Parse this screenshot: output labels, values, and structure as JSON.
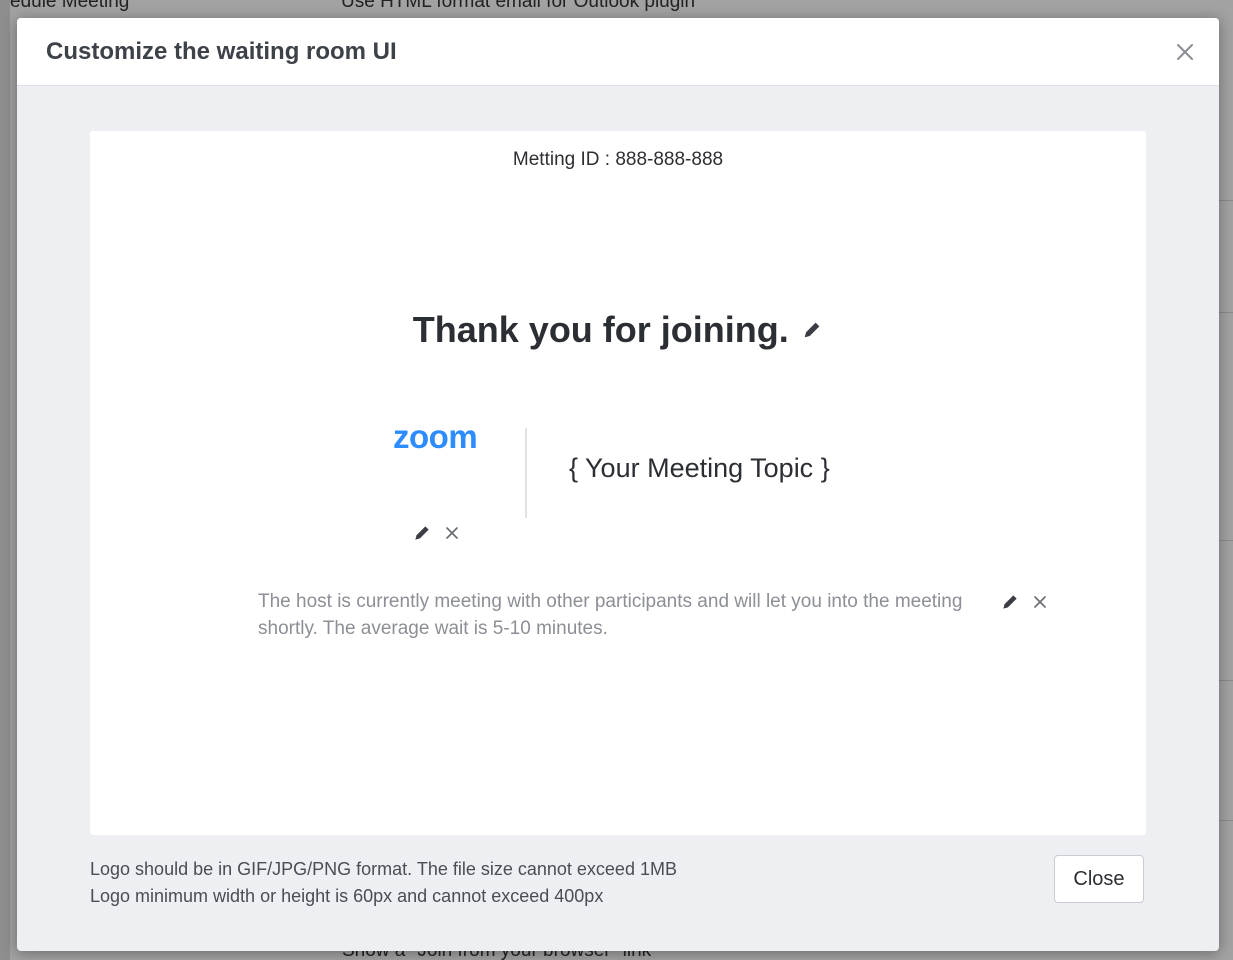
{
  "background_page": {
    "top_left_text": "edule Meeting",
    "top_center_text": "Use HTML format email for Outlook plugin",
    "bottom_center_text": "Show a \"Join from your browser\" link"
  },
  "dialog": {
    "title": "Customize the waiting room UI",
    "close_icon": "close-icon",
    "preview": {
      "meeting_id": "Metting ID : 888-888-888",
      "title": "Thank you for joining.",
      "logo_text": "zoom",
      "topic": "{ Your Meeting Topic }",
      "description": "The host is currently meeting with other participants and will let you into the meeting shortly. The average wait is 5-10 minutes.",
      "edit_icon": "pencil-icon",
      "remove_icon": "close-icon"
    },
    "notes": [
      "Logo should be in GIF/JPG/PNG format. The file size cannot exceed 1MB",
      "Logo minimum width or height is 60px and cannot exceed 400px"
    ],
    "close_label": "Close"
  },
  "colors": {
    "brand": "#2d8cff",
    "overlay": "#8e8e8e",
    "dialog_bg": "#eeeff3",
    "muted_text": "#8c8f96"
  }
}
